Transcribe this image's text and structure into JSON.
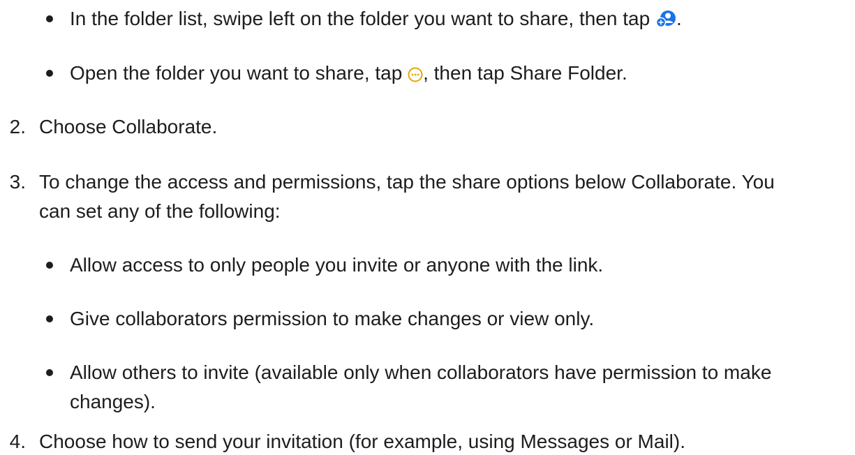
{
  "steps": {
    "step1_bullets": [
      {
        "before": "In the folder list, swipe left on the folder you want to share, then tap ",
        "icon": "add-person-icon",
        "after": "."
      },
      {
        "before": "Open the folder you want to share, tap ",
        "icon": "more-options-icon",
        "after": ", then tap Share Folder."
      }
    ],
    "step2": {
      "number": "2.",
      "text": "Choose Collaborate."
    },
    "step3": {
      "number": "3.",
      "line1": "To change the access and permissions, tap the share options below Collaborate. You",
      "line2": "can set any of the following:",
      "bullets": [
        {
          "text": "Allow access to only people you invite or anyone with the link."
        },
        {
          "text": "Give collaborators permission to make changes or view only."
        },
        {
          "line1": "Allow others to invite (available only when collaborators have permission to make",
          "line2": "changes)."
        }
      ]
    },
    "step4": {
      "number": "4.",
      "text": "Choose how to send your invitation (for example, using Messages or Mail)."
    }
  },
  "colors": {
    "text": "#1d1d1f",
    "accent_blue": "#1a73e8",
    "accent_yellow": "#e2a700"
  }
}
